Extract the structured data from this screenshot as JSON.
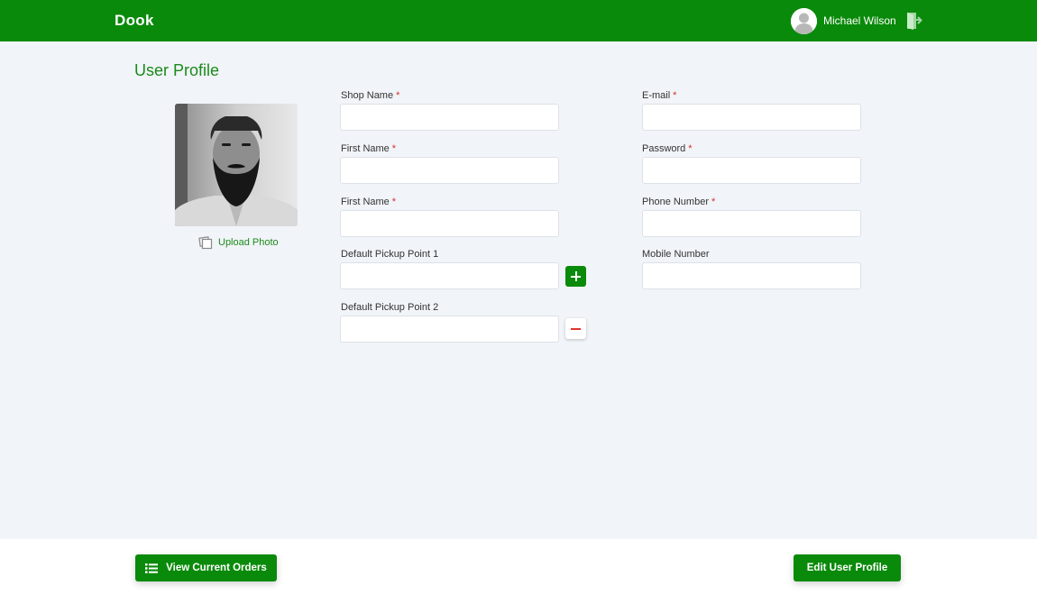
{
  "header": {
    "brand": "Dook",
    "user_name": "Michael Wilson",
    "avatar_icon": "user-avatar-icon",
    "logout_icon": "logout-door-icon"
  },
  "page": {
    "title": "User Profile"
  },
  "profile": {
    "photo": "user-profile-photo",
    "upload_label": "Upload Photo",
    "upload_icon": "photos-icon"
  },
  "form": {
    "shop_name": {
      "label": "Shop Name",
      "required": "*",
      "value": ""
    },
    "first_name": {
      "label": "First Name",
      "required": "*",
      "value": ""
    },
    "first_name_2": {
      "label": "First Name",
      "required": "*",
      "value": ""
    },
    "pickup_1": {
      "label": "Default Pickup Point 1",
      "value": ""
    },
    "pickup_2": {
      "label": "Default Pickup Point 2",
      "value": ""
    },
    "email": {
      "label": "E-mail",
      "required": "*",
      "value": ""
    },
    "password": {
      "label": "Password",
      "required": "*",
      "value": ""
    },
    "phone": {
      "label": "Phone Number",
      "required": "*",
      "value": ""
    },
    "mobile": {
      "label": "Mobile Number",
      "value": ""
    },
    "add_icon": "plus-icon",
    "remove_icon": "minus-icon"
  },
  "footer": {
    "view_orders_label": "View Current Orders",
    "view_orders_icon": "list-icon",
    "edit_profile_label": "Edit User Profile"
  },
  "colors": {
    "primary": "#0a8a0a",
    "title_green": "#1c8a1c",
    "required_red": "#d0302a",
    "remove_red": "#e0352d",
    "background": "#f1f4f8"
  }
}
